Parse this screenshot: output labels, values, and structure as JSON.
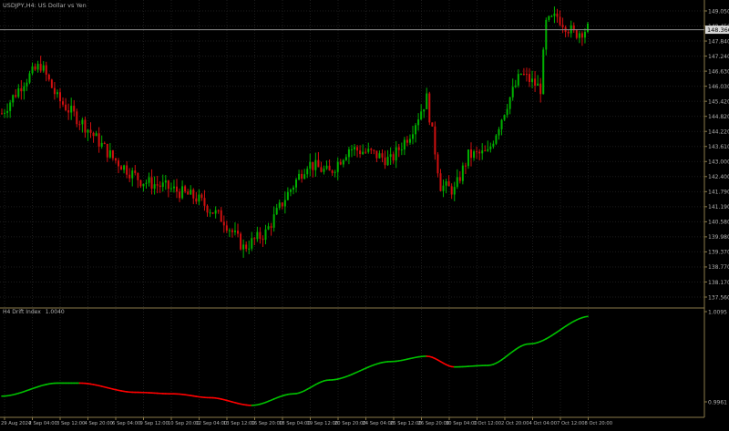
{
  "window": {
    "title": "USDJPY,H4: US Dollar vs Yen"
  },
  "price_panel": {
    "y_ticks": [
      "149.050",
      "148.450",
      "147.840",
      "147.240",
      "146.630",
      "146.030",
      "145.420",
      "144.820",
      "144.220",
      "143.610",
      "143.000",
      "142.400",
      "141.790",
      "141.190",
      "140.580",
      "139.980",
      "139.370",
      "138.770",
      "138.170",
      "137.560"
    ],
    "current_price_label": "148.366",
    "current_price": 148.366
  },
  "indicator_panel": {
    "title": "H4 Drift Index",
    "current_value": "1.0040",
    "y_ticks": [
      "1.0095",
      "0.9961"
    ]
  },
  "x_ticks": [
    "29 Aug 2024",
    "2 Sep 04:00",
    "3 Sep 12:00",
    "4 Sep 20:00",
    "6 Sep 04:00",
    "9 Sep 12:00",
    "10 Sep 20:00",
    "12 Sep 04:00",
    "13 Sep 12:00",
    "16 Sep 20:00",
    "18 Sep 04:00",
    "19 Sep 12:00",
    "20 Sep 20:00",
    "24 Sep 04:00",
    "25 Sep 12:00",
    "26 Sep 20:00",
    "30 Sep 04:00",
    "1 Oct 12:00",
    "2 Oct 20:00",
    "4 Oct 04:00",
    "7 Oct 12:00",
    "8 Oct 20:00"
  ],
  "colors": {
    "background": "#000000",
    "grid": "#1c1c1c",
    "axis": "#8a7a4a",
    "text": "#b0b0b0",
    "bull": "#00b000",
    "bear": "#d01010",
    "indicator_up": "#00c000",
    "indicator_down": "#ff0000",
    "price_line": "#8c8c8c"
  },
  "chart_data": [
    {
      "type": "candlestick",
      "title": "USDJPY,H4: US Dollar vs Yen",
      "ylim": [
        137.32,
        149.45
      ],
      "grid": true,
      "anchors": [
        {
          "i": 0,
          "p": 145.0
        },
        {
          "i": 8,
          "p": 146.3
        },
        {
          "i": 14,
          "p": 146.95
        },
        {
          "i": 20,
          "p": 145.6
        },
        {
          "i": 30,
          "p": 144.5
        },
        {
          "i": 40,
          "p": 143.2
        },
        {
          "i": 50,
          "p": 142.3
        },
        {
          "i": 60,
          "p": 142.0
        },
        {
          "i": 70,
          "p": 141.6
        },
        {
          "i": 80,
          "p": 140.7
        },
        {
          "i": 87,
          "p": 139.6
        },
        {
          "i": 95,
          "p": 140.2
        },
        {
          "i": 102,
          "p": 141.6
        },
        {
          "i": 110,
          "p": 143.0
        },
        {
          "i": 118,
          "p": 142.6
        },
        {
          "i": 125,
          "p": 143.6
        },
        {
          "i": 133,
          "p": 143.4
        },
        {
          "i": 140,
          "p": 143.1
        },
        {
          "i": 147,
          "p": 144.2
        },
        {
          "i": 153,
          "p": 145.6
        },
        {
          "i": 158,
          "p": 142.1
        },
        {
          "i": 163,
          "p": 141.9
        },
        {
          "i": 168,
          "p": 143.3
        },
        {
          "i": 175,
          "p": 143.4
        },
        {
          "i": 182,
          "p": 145.4
        },
        {
          "i": 187,
          "p": 146.6
        },
        {
          "i": 194,
          "p": 146.0
        },
        {
          "i": 196,
          "p": 148.6
        },
        {
          "i": 200,
          "p": 148.9
        },
        {
          "i": 206,
          "p": 148.2
        },
        {
          "i": 211,
          "p": 148.4
        }
      ],
      "count": 212
    },
    {
      "type": "line",
      "title": "H4 Drift Index",
      "ylim": [
        0.9961,
        1.0095
      ],
      "points": [
        {
          "x": 0,
          "y": 0.9985
        },
        {
          "x": 20,
          "y": 1.0002
        },
        {
          "x": 28,
          "y": 1.0002
        },
        {
          "x": 48,
          "y": 0.999
        },
        {
          "x": 62,
          "y": 0.9988
        },
        {
          "x": 75,
          "y": 0.9983
        },
        {
          "x": 90,
          "y": 0.9973
        },
        {
          "x": 105,
          "y": 0.9988
        },
        {
          "x": 118,
          "y": 1.0006
        },
        {
          "x": 140,
          "y": 1.003
        },
        {
          "x": 153,
          "y": 1.0037
        },
        {
          "x": 163,
          "y": 1.0023
        },
        {
          "x": 175,
          "y": 1.0025
        },
        {
          "x": 190,
          "y": 1.0053
        },
        {
          "x": 212,
          "y": 1.0089
        }
      ]
    }
  ]
}
